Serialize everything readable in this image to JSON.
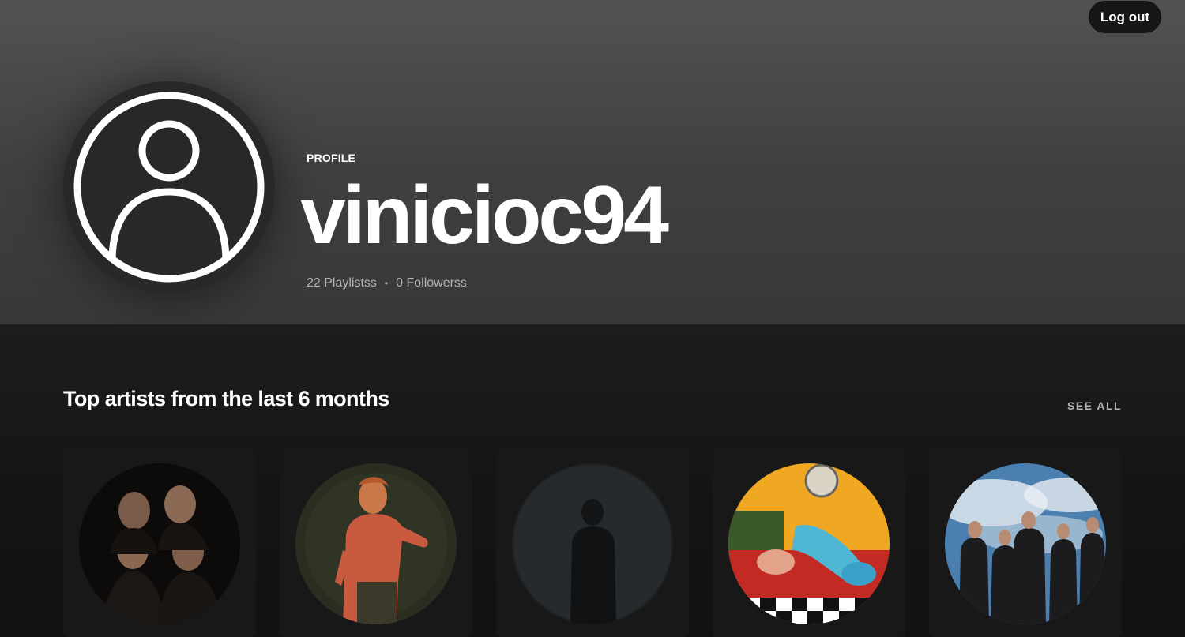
{
  "topbar": {
    "logout_label": "Log out"
  },
  "profile": {
    "type_label": "PROFILE",
    "username": "vinicioc94",
    "playlists": "22 Playlistss",
    "separator": "•",
    "followers": "0 Followerss"
  },
  "top_artists": {
    "title": "Top artists from the last 6 months",
    "see_all_label": "SEE ALL",
    "artists": [
      {
        "image": "band-portrait-dark"
      },
      {
        "image": "singer-orange-shirt"
      },
      {
        "image": "dark-silhouette"
      },
      {
        "image": "colorful-band-photo"
      },
      {
        "image": "band-blue-sky"
      }
    ]
  },
  "icons": {
    "avatar": "user-icon"
  },
  "colors": {
    "background": "#121212",
    "card": "#181818",
    "muted_text": "#b3b3b3"
  }
}
